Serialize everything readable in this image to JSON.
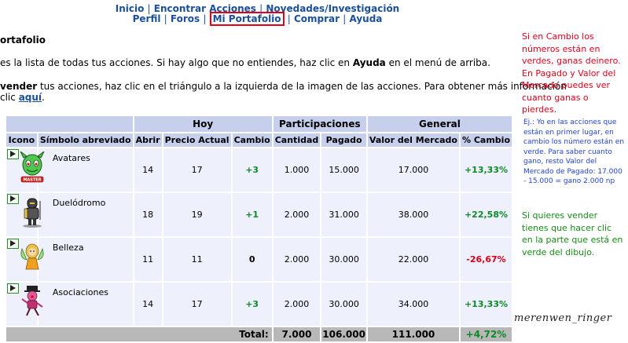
{
  "nav": {
    "row1": [
      "Inicio",
      "Encontrar Acciones",
      "Novedades/Investigación"
    ],
    "row2": [
      "Perfil",
      "Foros",
      "Mi Portafolio",
      "Comprar",
      "Ayuda"
    ]
  },
  "page": {
    "heading": "ortafolio",
    "p1_before": "es la lista de todas tus acciones. Si hay algo que no entiendes, haz clic en ",
    "p1_bold": "Ayuda",
    "p1_after": " en el menú de arriba.",
    "p2_bold": "vender",
    "p2_rest": " tus acciones, haz clic en el triángulo a la izquierda de la imagen de las acciones. Para obtener más información",
    "p3_before": "clic ",
    "p3_link": "aquí",
    "p3_after": "."
  },
  "table": {
    "group_headers": [
      "Hoy",
      "Participaciones",
      "General"
    ],
    "columns": [
      "Icono",
      "Símbolo abreviado",
      "Abrir",
      "Precio Actual",
      "Cambio",
      "Cantidad",
      "Pagado",
      "Valor del Mercado",
      "% Cambio"
    ],
    "rows": [
      {
        "name": "Avatares",
        "abrir": "14",
        "precio": "17",
        "cambio": "+3",
        "cambio_class": "pos",
        "cantidad": "1.000",
        "pagado": "15.000",
        "valor": "17.000",
        "pct": "+13,33%",
        "pct_class": "pos"
      },
      {
        "name": "Duelódromo",
        "abrir": "18",
        "precio": "19",
        "cambio": "+1",
        "cambio_class": "pos",
        "cantidad": "2.000",
        "pagado": "31.000",
        "valor": "38.000",
        "pct": "+22,58%",
        "pct_class": "pos"
      },
      {
        "name": "Belleza",
        "abrir": "11",
        "precio": "11",
        "cambio": "0",
        "cambio_class": "zero",
        "cantidad": "2.000",
        "pagado": "30.000",
        "valor": "22.000",
        "pct": "-26,67%",
        "pct_class": "neg"
      },
      {
        "name": "Asociaciones",
        "abrir": "14",
        "precio": "17",
        "cambio": "+3",
        "cambio_class": "pos",
        "cantidad": "2.000",
        "pagado": "30.000",
        "valor": "34.000",
        "pct": "+13,33%",
        "pct_class": "pos"
      }
    ],
    "total": {
      "label": "Total:",
      "cantidad": "7.000",
      "pagado": "106.000",
      "valor": "111.000",
      "pct": "+4,72%"
    }
  },
  "avatar_badge_text": "MASTER",
  "notes": {
    "red": "Si en Cambio los números están en verdes, ganas deinero. En Pagado y Valor del Mercado puedes ver cuanto ganas o pierdes.",
    "blue": "Ej.: Yo en las acciones que están en primer lugar, en cambio los número están en verde. Para saber cuanto gano, resto Valor del Mercado de Pagado: 17.000 - 15.000 = gano 2.000 np",
    "green": "Si quieres vender tienes que hacer clic en la parte que está en verde del dibujo."
  },
  "signature": "merenwen_ringer",
  "colors": {
    "header_bg": "#c6cfec",
    "cell_bg": "#eef0fb",
    "total_bg": "#b8b8b8",
    "positive": "#0a8a28",
    "negative": "#d4001a",
    "link": "#1a4f9c",
    "highlight_border": "#e0001a"
  }
}
